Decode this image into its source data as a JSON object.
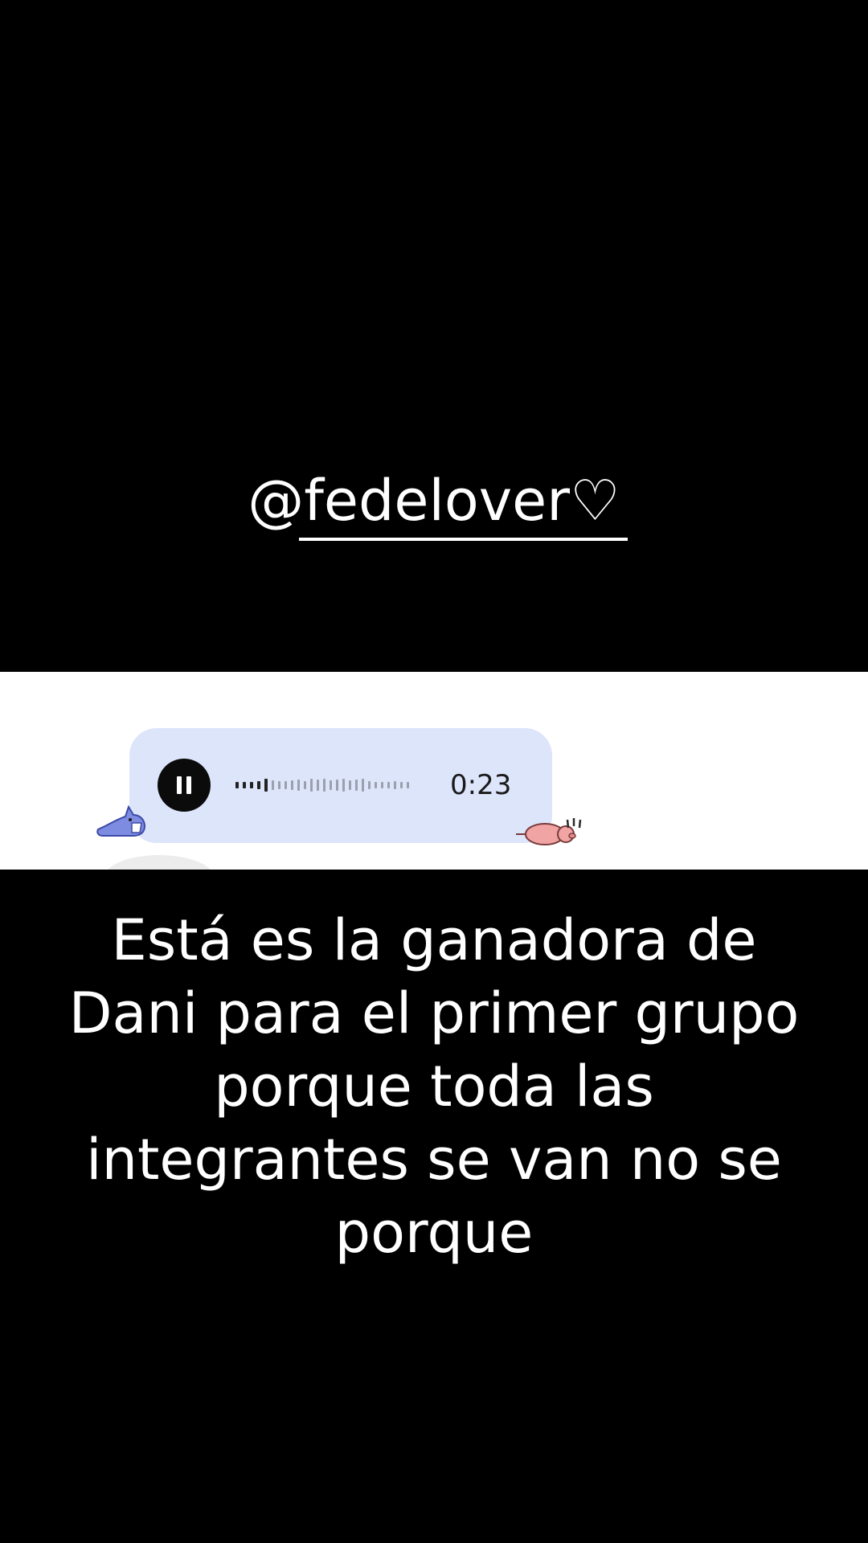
{
  "overlay": {
    "username": "@fedelover♡"
  },
  "voice_message": {
    "duration": "0:23",
    "state": "playing",
    "bubble_color": "#dde5fb",
    "pause_icon": "pause-icon"
  },
  "stickers": {
    "left": "shark-sticker-icon",
    "right": "pig-sticker-icon"
  },
  "caption": {
    "text": "Está es la ganadora de Dani para el primer grupo porque toda las integrantes se van no se porque"
  },
  "colors": {
    "background": "#000000",
    "text": "#ffffff",
    "strip": "#ffffff"
  }
}
